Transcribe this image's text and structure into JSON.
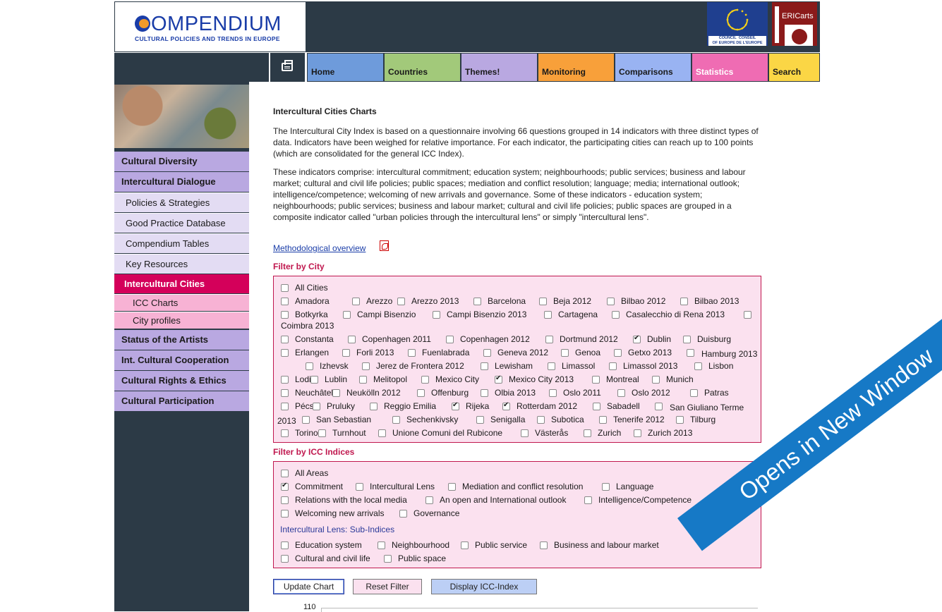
{
  "header": {
    "logo_title": "OMPENDIUM",
    "logo_subtitle": "CULTURAL POLICIES AND TRENDS IN EUROPE",
    "coe_text": "COUNCIL   CONSEIL\nOF EUROPE   DE L'EUROPE",
    "ericarts_text": "ERICarts"
  },
  "nav": {
    "tabs": [
      {
        "label": "Home",
        "color": "#6e9bdb"
      },
      {
        "label": "Countries",
        "color": "#a2c97a"
      },
      {
        "label": "Themes!",
        "color": "#b9a8e1"
      },
      {
        "label": "Monitoring",
        "color": "#f8a03a"
      },
      {
        "label": "Comparisons",
        "color": "#99b3f2"
      },
      {
        "label": "Statistics",
        "color": "#ef6cb3"
      },
      {
        "label": "Search",
        "color": "#fbd645"
      }
    ]
  },
  "sidebar": {
    "items": [
      {
        "label": "Cultural Diversity"
      },
      {
        "label": "Intercultural Dialogue"
      },
      {
        "label": "Policies & Strategies"
      },
      {
        "label": "Good Practice Database"
      },
      {
        "label": "Compendium Tables"
      },
      {
        "label": "Key Resources"
      },
      {
        "label": "Intercultural Cities"
      },
      {
        "label": "ICC Charts"
      },
      {
        "label": "City profiles"
      },
      {
        "label": "Status of the Artists"
      },
      {
        "label": "Int. Cultural Cooperation"
      },
      {
        "label": "Cultural Rights & Ethics"
      },
      {
        "label": "Cultural Participation"
      }
    ]
  },
  "main": {
    "title": "Intercultural Cities Charts",
    "para1": "The Intercultural City Index is based on a questionnaire involving 66 questions grouped in 14 indicators with three distinct types of data. Indicators have been weighed for relative importance.  For each indicator, the participating cities can reach up to 100 points (which are consolidated for the general ICC Index).",
    "para2": "These indicators comprise: intercultural commitment; education system; neighbourhoods; public services; business and labour market; cultural and civil life policies;   public spaces; mediation and conflict resolution; language; media; international outlook; intelligence/competence; welcoming of new arrivals and governance. Some of these indicators - education system; neighbourhoods; public services; business and labour market; cultural and civil life policies;   public spaces are grouped in a composite indicator called \"urban policies through the intercultural lens\" or simply \"intercultural lens\".",
    "method_link": "Methodological overview",
    "filter_city_heading": "Filter by City",
    "filter_icc_heading": "Filter by ICC Indices",
    "sub_indices_heading": "Intercultural Lens: Sub-Indices",
    "buttons": {
      "update": "Update Chart",
      "reset": "Reset Filter",
      "display": "Display ICC-Index"
    },
    "chart_y_tick": "110"
  },
  "cities": [
    {
      "label": "All Cities",
      "checked": false
    },
    {
      "label": "Amadora",
      "checked": false
    },
    {
      "label": "Arezzo",
      "checked": false
    },
    {
      "label": "Arezzo 2013",
      "checked": false
    },
    {
      "label": "Barcelona",
      "checked": false
    },
    {
      "label": "Beja 2012",
      "checked": false
    },
    {
      "label": "Bilbao 2012",
      "checked": false
    },
    {
      "label": "Bilbao 2013",
      "checked": false
    },
    {
      "label": "Botkyrka",
      "checked": false
    },
    {
      "label": "Campi Bisenzio",
      "checked": false
    },
    {
      "label": "Campi Bisenzio 2013",
      "checked": false
    },
    {
      "label": "Cartagena",
      "checked": false
    },
    {
      "label": "Casalecchio di Rena 2013",
      "checked": false
    },
    {
      "label": "Coimbra 2013",
      "checked": false
    },
    {
      "label": "Constanta",
      "checked": false
    },
    {
      "label": "Copenhagen 2011",
      "checked": false
    },
    {
      "label": "Copenhagen 2012",
      "checked": false
    },
    {
      "label": "Dortmund 2012",
      "checked": false
    },
    {
      "label": "Dublin",
      "checked": true
    },
    {
      "label": "Duisburg",
      "checked": false
    },
    {
      "label": "Erlangen",
      "checked": false
    },
    {
      "label": "Forli 2013",
      "checked": false
    },
    {
      "label": "Fuenlabrada",
      "checked": false
    },
    {
      "label": "Geneva 2012",
      "checked": false
    },
    {
      "label": "Genoa",
      "checked": false
    },
    {
      "label": "Getxo 2013",
      "checked": false
    },
    {
      "label": "Hamburg 2013",
      "checked": false
    },
    {
      "label": "Izhevsk",
      "checked": false
    },
    {
      "label": "Jerez de Frontera 2012",
      "checked": false
    },
    {
      "label": "Lewisham",
      "checked": false
    },
    {
      "label": "Limassol",
      "checked": false
    },
    {
      "label": "Limassol 2013",
      "checked": false
    },
    {
      "label": "Lisbon",
      "checked": false
    },
    {
      "label": "Lodi",
      "checked": false
    },
    {
      "label": "Lublin",
      "checked": false
    },
    {
      "label": "Melitopol",
      "checked": false
    },
    {
      "label": "Mexico City",
      "checked": false
    },
    {
      "label": "Mexico City 2013",
      "checked": true
    },
    {
      "label": "Montreal",
      "checked": false
    },
    {
      "label": "Munich",
      "checked": false
    },
    {
      "label": "Neuchâtel",
      "checked": false
    },
    {
      "label": "Neukölln 2012",
      "checked": false
    },
    {
      "label": "Offenburg",
      "checked": false
    },
    {
      "label": "Olbia 2013",
      "checked": false
    },
    {
      "label": "Oslo 2011",
      "checked": false
    },
    {
      "label": "Oslo 2012",
      "checked": false
    },
    {
      "label": "Patras",
      "checked": false
    },
    {
      "label": "Pécs",
      "checked": false
    },
    {
      "label": "Pruluky",
      "checked": false
    },
    {
      "label": "Reggio Emilia",
      "checked": false
    },
    {
      "label": "Rijeka",
      "checked": true
    },
    {
      "label": "Rotterdam 2012",
      "checked": true
    },
    {
      "label": "Sabadell",
      "checked": false
    },
    {
      "label": "San Giuliano Terme 2013",
      "checked": false
    },
    {
      "label": "San Sebastian",
      "checked": false
    },
    {
      "label": "Sechenkivsky",
      "checked": false
    },
    {
      "label": "Senigalla",
      "checked": false
    },
    {
      "label": "Subotica",
      "checked": false
    },
    {
      "label": "Tenerife 2012",
      "checked": false
    },
    {
      "label": "Tilburg",
      "checked": false
    },
    {
      "label": "Torino",
      "checked": false
    },
    {
      "label": "Turnhout",
      "checked": false
    },
    {
      "label": "Unione Comuni del Rubicone",
      "checked": false
    },
    {
      "label": "Västerås",
      "checked": false
    },
    {
      "label": "Zurich",
      "checked": false
    },
    {
      "label": "Zurich 2013",
      "checked": false
    }
  ],
  "indices": [
    {
      "label": "All Areas",
      "checked": false
    },
    {
      "label": "Commitment",
      "checked": true
    },
    {
      "label": "Intercultural Lens",
      "checked": false
    },
    {
      "label": "Mediation and conflict resolution",
      "checked": false
    },
    {
      "label": "Language",
      "checked": false
    },
    {
      "label": "Relations with the local media",
      "checked": false
    },
    {
      "label": "An open and International outlook",
      "checked": false
    },
    {
      "label": "Intelligence/Competence",
      "checked": false
    },
    {
      "label": "Welcoming new arrivals",
      "checked": false
    },
    {
      "label": "Governance",
      "checked": false
    }
  ],
  "sub_indices": [
    {
      "label": "Education system",
      "checked": false
    },
    {
      "label": "Neighbourhood",
      "checked": false
    },
    {
      "label": "Public service",
      "checked": false
    },
    {
      "label": "Business and labour market",
      "checked": false
    },
    {
      "label": "Cultural and civil life",
      "checked": false
    },
    {
      "label": "Public space",
      "checked": false
    }
  ],
  "ribbon": {
    "text": "Opens in New Window",
    "color": "#1679c6"
  }
}
